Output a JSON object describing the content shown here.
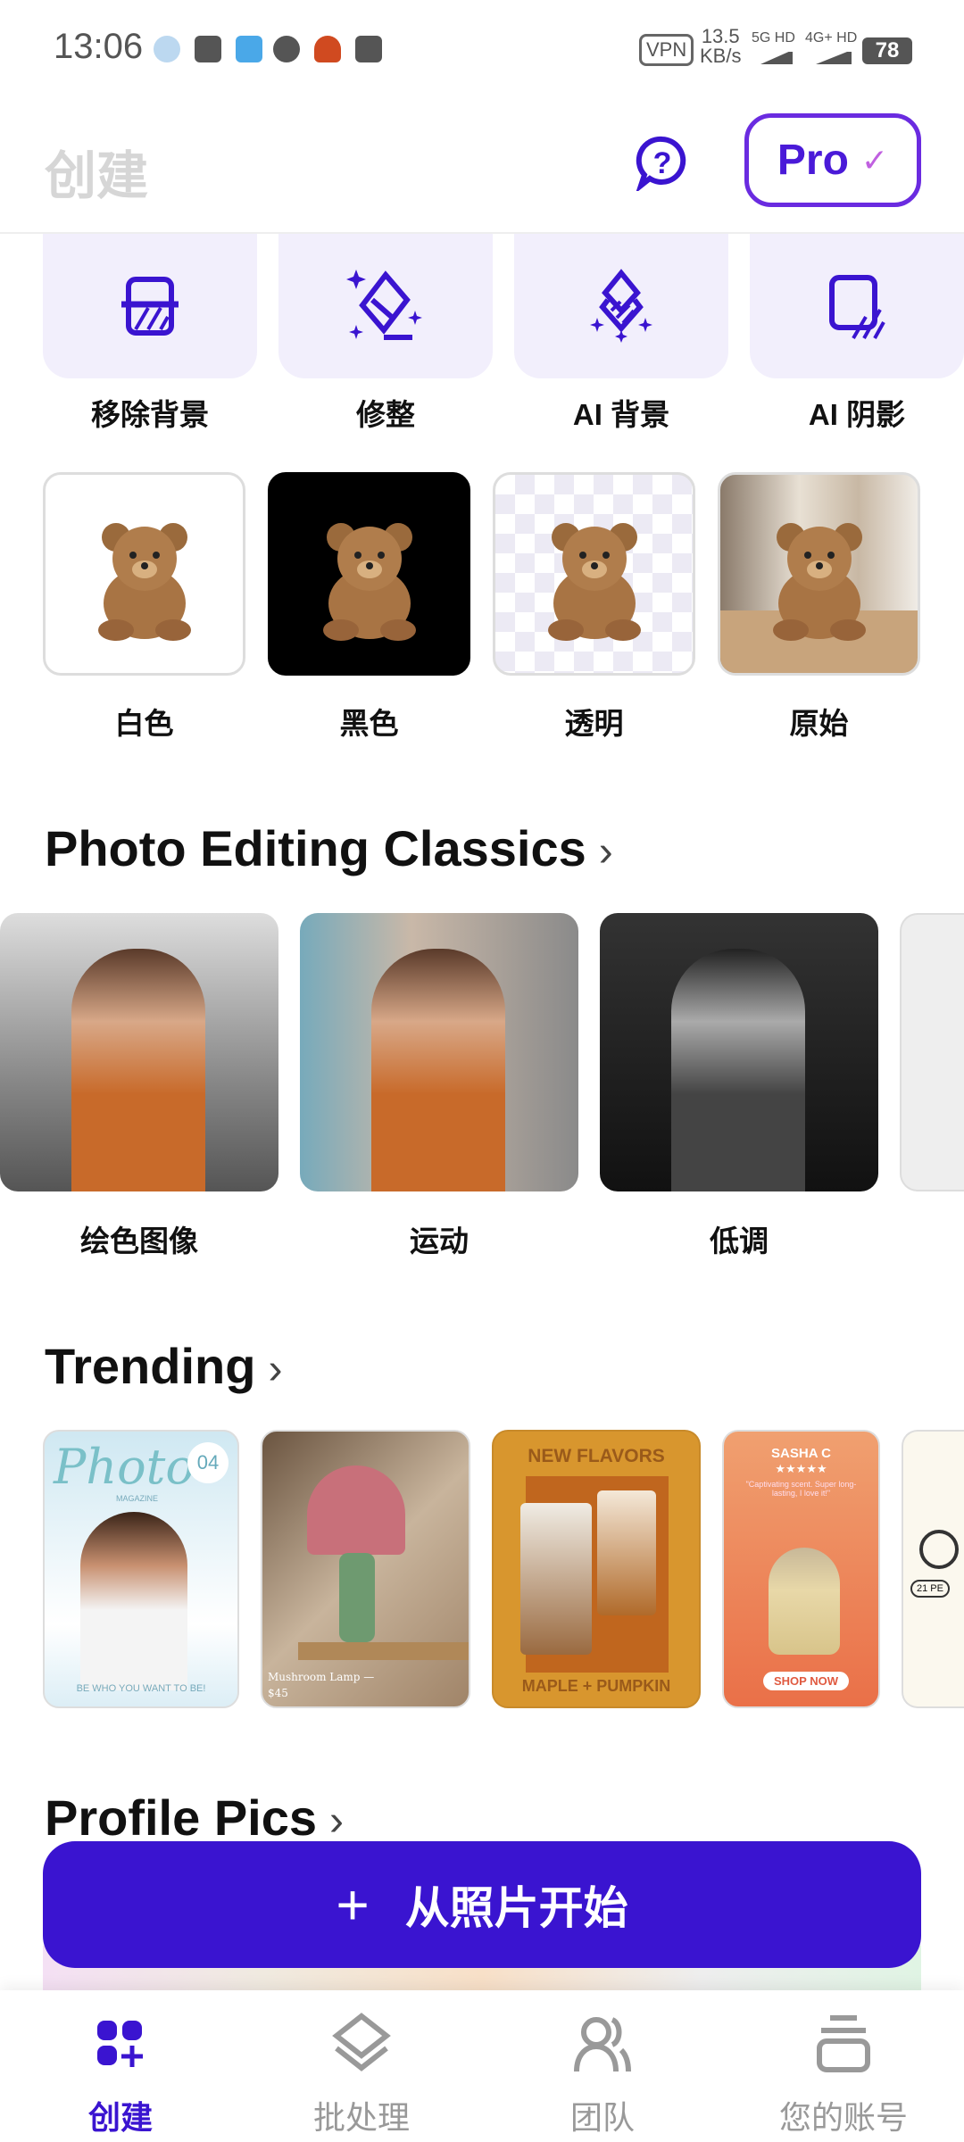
{
  "status_bar": {
    "time": "13:06",
    "vpn": "VPN",
    "speed": "13.5",
    "speed_unit": "KB/s",
    "net1": "5G HD",
    "net2": "4G+ HD",
    "battery": "78"
  },
  "header": {
    "title": "创建",
    "pro_label": "Pro",
    "pro_check": "✓"
  },
  "tools": [
    {
      "label": "移除背景",
      "icon": "remove-background-icon"
    },
    {
      "label": "修整",
      "icon": "eraser-sparkle-icon"
    },
    {
      "label": "AI 背景",
      "icon": "layers-sparkle-icon"
    },
    {
      "label": "AI 阴影",
      "icon": "shadow-icon"
    }
  ],
  "backgrounds": [
    {
      "label": "白色"
    },
    {
      "label": "黑色"
    },
    {
      "label": "透明"
    },
    {
      "label": "原始"
    }
  ],
  "classics": {
    "title": "Photo Editing Classics",
    "items": [
      {
        "label": "绘色图像"
      },
      {
        "label": "运动"
      },
      {
        "label": "低调"
      }
    ]
  },
  "trending": {
    "title": "Trending",
    "cards": [
      {
        "big": "Photo",
        "small": "MAGAZINE",
        "num": "04",
        "foot": "BE WHO YOU WANT TO BE!"
      },
      {
        "foot": "Mushroom Lamp —",
        "price": "$45"
      },
      {
        "head": "NEW FLAVORS",
        "foot": "MAPLE + PUMPKIN"
      },
      {
        "head": "SASHA C",
        "stars": "★★★★★",
        "quote": "\"Captivating scent. Super long-lasting, I love it!\"",
        "button": "SHOP NOW"
      },
      {
        "tag": "21 PE"
      }
    ]
  },
  "profile": {
    "title": "Profile Pics"
  },
  "cta": {
    "icon": "+",
    "label": "从照片开始"
  },
  "nav": [
    {
      "label": "创建",
      "active": true
    },
    {
      "label": "批处理"
    },
    {
      "label": "团队"
    },
    {
      "label": "您的账号"
    }
  ],
  "colors": {
    "accent": "#3a14d0",
    "tile": "#f2effc"
  }
}
